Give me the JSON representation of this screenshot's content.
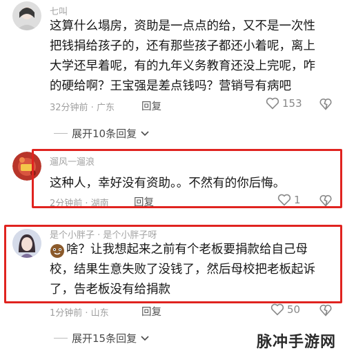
{
  "comments": [
    {
      "username": "七叫",
      "text_lines": [
        "这算什么塌房，资助是一点点的给，又不是一次性",
        "把钱捐给孩子的，还有那些孩子都还小着呢，离上",
        "大学还早着呢，有的九年义务教育还没上完呢，咋",
        "的硬给啊？王宝强是差点钱吗？营销号有病吧"
      ],
      "meta": "32分钟前 · 广东",
      "reply": "回复",
      "likes": "153",
      "expand": "展开10条回复"
    },
    {
      "username": "遛风一遛浪",
      "text_lines": [
        "这种人，幸好没有资助。。不然有的你后悔。"
      ],
      "meta": "2分钟前 · 湖南",
      "reply": "回复",
      "likes": "1"
    },
    {
      "username": "是个小胖子 · 是个小胖子呀",
      "text_lines": [
        "啥？让我想起来之前有个老板要捐款给自己母",
        "校，结果生意失败了没钱了，然后母校把老板起诉",
        "了，告老板没有给捐款"
      ],
      "meta": "1分钟前 · 山东",
      "reply": "回复",
      "likes": "50",
      "expand": "展开15条回复"
    }
  ],
  "watermark": "脉冲手游网",
  "colors": {
    "highlight_border": "#e0231f",
    "meta_text": "#9e9e9e",
    "body_text": "#161616"
  },
  "icons": [
    "heart-outline-icon",
    "thumb-down-icon",
    "chevron-down-icon",
    "emoji-sticker-icon"
  ]
}
